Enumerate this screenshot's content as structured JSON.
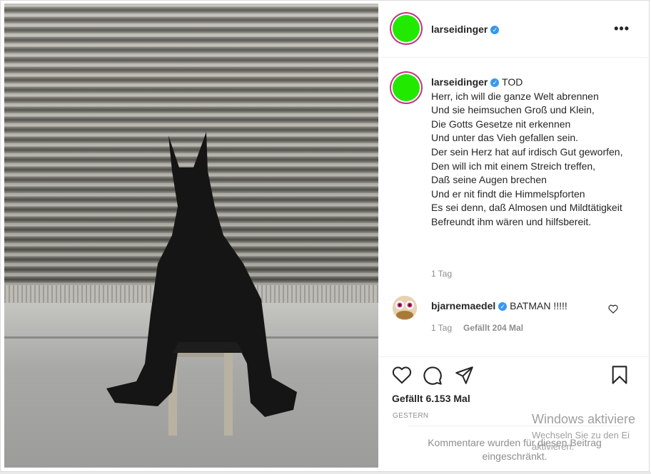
{
  "post": {
    "author": "larseidinger",
    "verified_icon": "verified-badge-icon",
    "more_icon": "more-options-icon"
  },
  "caption": {
    "author": "larseidinger",
    "first_word": "TOD",
    "poem": "Herr, ich will die ganze Welt abrennen\nUnd sie heimsuchen Groß und Klein,\nDie Gotts Gesetze nit erkennen\nUnd unter das Vieh gefallen sein.\nDer sein Herz hat auf irdisch Gut geworfen,\nDen will ich mit einem Streich treffen,\nDaß seine Augen brechen\nUnd er nit findt die Himmelspforten\nEs sei denn, daß Almosen und Mildtätigkeit\nBefreundt ihm wären und hilfsbereit.",
    "time": "1 Tag"
  },
  "comment": {
    "author": "bjarnemaedel",
    "text": "BATMAN !!!!!",
    "time": "1 Tag",
    "likes": "Gefällt 204 Mal"
  },
  "actions": {
    "like_icon": "heart-icon",
    "comment_icon": "comment-icon",
    "share_icon": "share-icon",
    "save_icon": "bookmark-icon"
  },
  "likes_label": "Gefällt 6.153 Mal",
  "date_label": "GESTERN",
  "comments_disabled": "Kommentare wurden für diesen Beitrag eingeschränkt.",
  "windows_overlay": {
    "title": "Windows aktiviere",
    "subtitle": "Wechseln Sie zu den Ei aktivieren."
  },
  "colors": {
    "avatar": "#22e900",
    "verified": "#3897f0",
    "text": "#262626",
    "muted": "#8e8e8e"
  }
}
